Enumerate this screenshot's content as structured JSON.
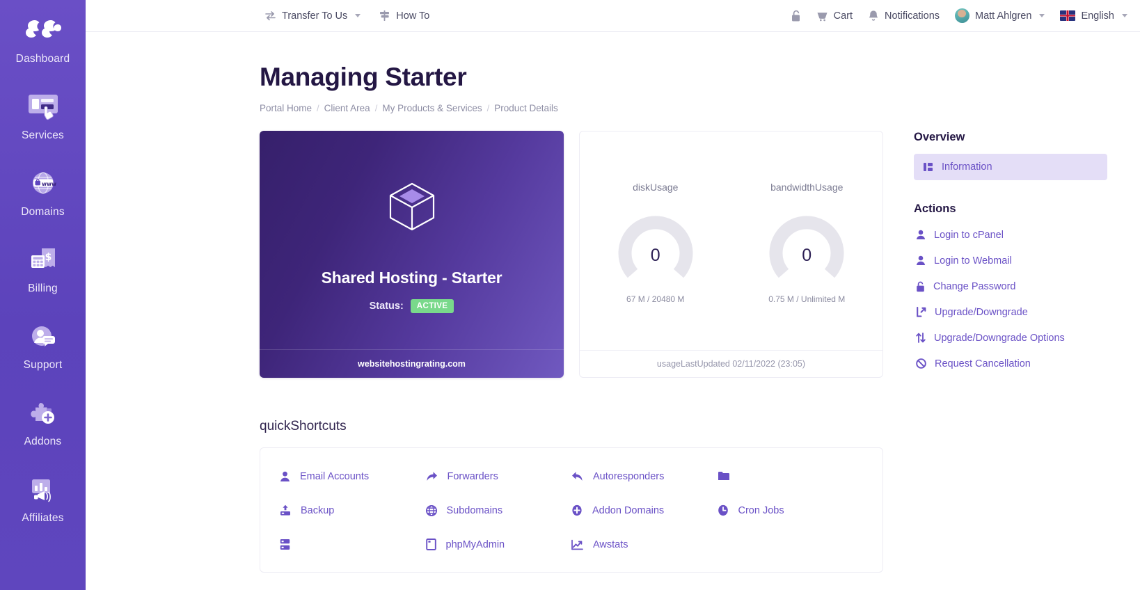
{
  "sidebar": {
    "items": [
      {
        "label": "Dashboard",
        "icon": "logo-icon"
      },
      {
        "label": "Services",
        "icon": "monitor-cursor-icon"
      },
      {
        "label": "Domains",
        "icon": "globe-www-lock-icon"
      },
      {
        "label": "Billing",
        "icon": "calculator-invoice-icon"
      },
      {
        "label": "Support",
        "icon": "agent-chat-icon"
      },
      {
        "label": "Addons",
        "icon": "puzzle-plus-icon"
      },
      {
        "label": "Affiliates",
        "icon": "chart-megaphone-icon"
      }
    ]
  },
  "topbar": {
    "left": [
      {
        "label": "Transfer To Us",
        "icon": "transfer-icon",
        "caret": true
      },
      {
        "label": "How To",
        "icon": "signpost-icon",
        "caret": false
      }
    ],
    "right": [
      {
        "label": "",
        "icon": "unlock-icon",
        "caret": false
      },
      {
        "label": "Cart",
        "icon": "cart-icon",
        "caret": false
      },
      {
        "label": "Notifications",
        "icon": "bell-icon",
        "caret": false
      },
      {
        "label": "Matt Ahlgren",
        "icon": "avatar",
        "caret": true
      },
      {
        "label": "English",
        "icon": "flag-uk-icon",
        "caret": true
      }
    ]
  },
  "page": {
    "title": "Managing Starter",
    "breadcrumb": [
      "Portal Home",
      "Client Area",
      "My Products & Services",
      "Product Details"
    ],
    "breadcrumb_separator": "/"
  },
  "product_card": {
    "icon": "cube-icon",
    "name": "Shared Hosting - Starter",
    "status_label": "Status:",
    "status_value": "ACTIVE",
    "footer": "websitehostingrating.com",
    "status_color": "#79D98B",
    "gradient_from": "#36206B",
    "gradient_to": "#7059C0"
  },
  "usage_card": {
    "gauges": [
      {
        "title": "diskUsage",
        "value": "0",
        "detail": "67 M / 20480 M",
        "percent": 0
      },
      {
        "title": "bandwidthUsage",
        "value": "0",
        "detail": "0.75 M / Unlimited M",
        "percent": 0
      }
    ],
    "footer": "usageLastUpdated 02/11/2022 (23:05)"
  },
  "right_rail": {
    "overview_heading": "Overview",
    "overview_items": [
      {
        "label": "Information",
        "icon": "layout-blocks-icon",
        "active": true
      }
    ],
    "actions_heading": "Actions",
    "actions": [
      {
        "label": "Login to cPanel",
        "icon": "user-icon"
      },
      {
        "label": "Login to Webmail",
        "icon": "user-icon"
      },
      {
        "label": "Change Password",
        "icon": "lock-icon"
      },
      {
        "label": "Upgrade/Downgrade",
        "icon": "external-link-icon"
      },
      {
        "label": "Upgrade/Downgrade Options",
        "icon": "updown-arrows-icon"
      },
      {
        "label": "Request Cancellation",
        "icon": "ban-icon"
      }
    ]
  },
  "shortcuts": {
    "title": "quickShortcuts",
    "items": [
      {
        "label": "Email Accounts",
        "icon": "user-icon"
      },
      {
        "label": "Forwarders",
        "icon": "forward-arrow-icon"
      },
      {
        "label": "Autoresponders",
        "icon": "reply-arrow-icon"
      },
      {
        "label": "",
        "icon": "folder-icon"
      },
      {
        "label": "Backup",
        "icon": "backup-upload-icon"
      },
      {
        "label": "Subdomains",
        "icon": "globe-icon"
      },
      {
        "label": "Addon Domains",
        "icon": "plus-circle-icon"
      },
      {
        "label": "Cron Jobs",
        "icon": "clock-icon"
      },
      {
        "label": "",
        "icon": "database-icon"
      },
      {
        "label": "phpMyAdmin",
        "icon": "database-page-icon"
      },
      {
        "label": "Awstats",
        "icon": "line-chart-icon"
      }
    ]
  },
  "theme": {
    "sidebar_purple": "#5F46BE",
    "accent_purple": "#6A51C6",
    "heading_navy": "#241744",
    "active_bg": "#E4DEF7"
  }
}
